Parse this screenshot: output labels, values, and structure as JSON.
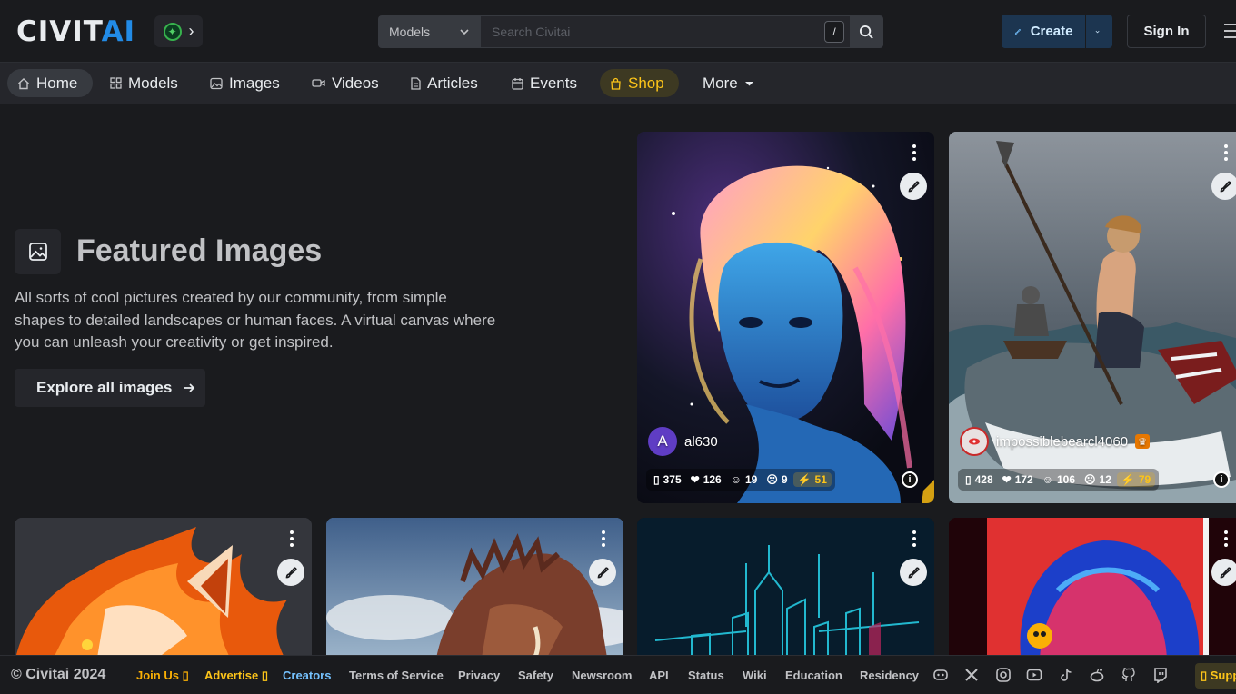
{
  "header": {
    "logo_main": "CIVIT",
    "logo_accent": "AI",
    "search_type": "Models",
    "search_placeholder": "Search Civitai",
    "search_shortcut": "/",
    "create_label": "Create",
    "signin_label": "Sign In"
  },
  "nav": {
    "items": [
      {
        "label": "Home",
        "icon": "home-icon"
      },
      {
        "label": "Models",
        "icon": "grid-icon"
      },
      {
        "label": "Images",
        "icon": "photo-icon"
      },
      {
        "label": "Videos",
        "icon": "video-icon"
      },
      {
        "label": "Articles",
        "icon": "file-icon"
      },
      {
        "label": "Events",
        "icon": "calendar-icon"
      },
      {
        "label": "Shop",
        "icon": "shopping-bag-icon"
      },
      {
        "label": "More",
        "icon": "caret-down-icon"
      }
    ]
  },
  "featured": {
    "title": "Featured Images",
    "description": "All sorts of cool pictures created by our community, from simple shapes to detailed landscapes or human faces. A virtual canvas where you can unleash your creativity or get inspired.",
    "explore_label": "Explore all images"
  },
  "cards": [
    {
      "username": "al630",
      "avatar_letter": "A",
      "views": "375",
      "likes": "126",
      "laughs": "19",
      "comments": "9",
      "buzz": "51"
    },
    {
      "username": "impossiblebearcl4060",
      "avatar_letter": "",
      "views": "428",
      "likes": "172",
      "laughs": "106",
      "comments": "12",
      "buzz": "79"
    }
  ],
  "footer": {
    "copyright": "© Civitai 2024",
    "join_us": "Join Us",
    "advertise": "Advertise",
    "links": [
      "Creators",
      "Terms of Service",
      "Privacy",
      "Safety",
      "Newsroom",
      "API",
      "Status",
      "Wiki",
      "Education",
      "Residency"
    ],
    "support": "Supp"
  },
  "colors": {
    "accent": "#228be6",
    "shop": "#fcc419",
    "background": "#1a1b1e"
  }
}
